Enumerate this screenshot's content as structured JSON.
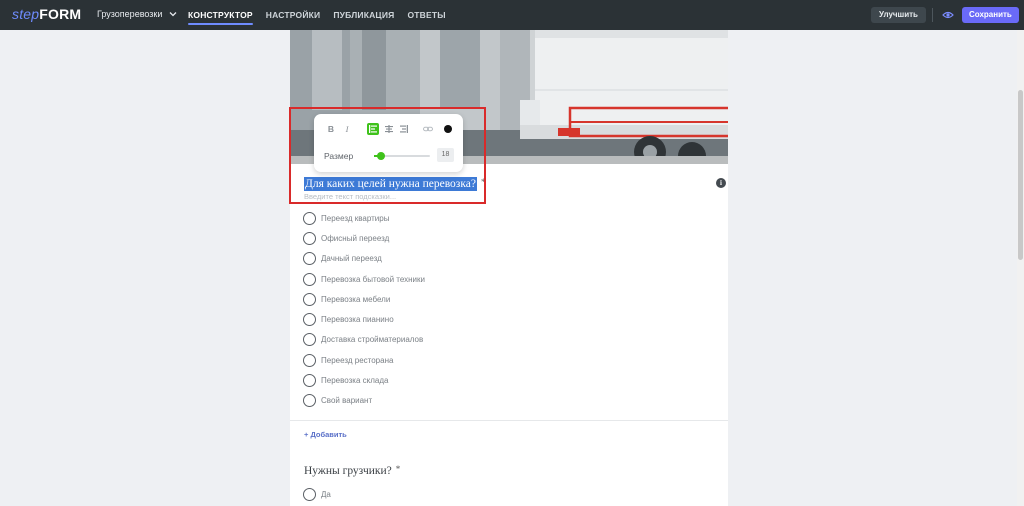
{
  "app": {
    "logo_step": "step",
    "logo_form": "FORM"
  },
  "header": {
    "project_name": "Грузоперевозки",
    "tabs": [
      {
        "label": "КОНСТРУКТОР",
        "active": true
      },
      {
        "label": "НАСТРОЙКИ",
        "active": false
      },
      {
        "label": "ПУБЛИКАЦИЯ",
        "active": false
      },
      {
        "label": "ОТВЕТЫ",
        "active": false
      }
    ],
    "improve_label": "Улучшить",
    "save_label": "Сохранить",
    "accent_color": "#6a6af7"
  },
  "toolbar": {
    "buttons": [
      "B",
      "I",
      "align-left",
      "align-center",
      "align-right",
      "link"
    ],
    "active_button": "align-left",
    "size_label": "Размер",
    "size_value": "18",
    "slider_fraction": 0.12,
    "text_color": "#111111",
    "active_color": "#3fc21b"
  },
  "question1": {
    "title": "Для каких целей нужна перевозка?",
    "required_mark": "*",
    "hint_placeholder": "Введите текст подсказки...",
    "options": [
      "Переезд квартиры",
      "Офисный переезд",
      "Дачный переезд",
      "Перевозка бытовой техники",
      "Перевозка мебели",
      "Перевозка пианино",
      "Доставка стройматериалов",
      "Переезд ресторана",
      "Перевозка склада",
      "Свой вариант"
    ],
    "add_label": "+ Добавить"
  },
  "question2": {
    "title": "Нужны грузчики?",
    "required_mark": "*",
    "options": [
      "Да"
    ]
  }
}
